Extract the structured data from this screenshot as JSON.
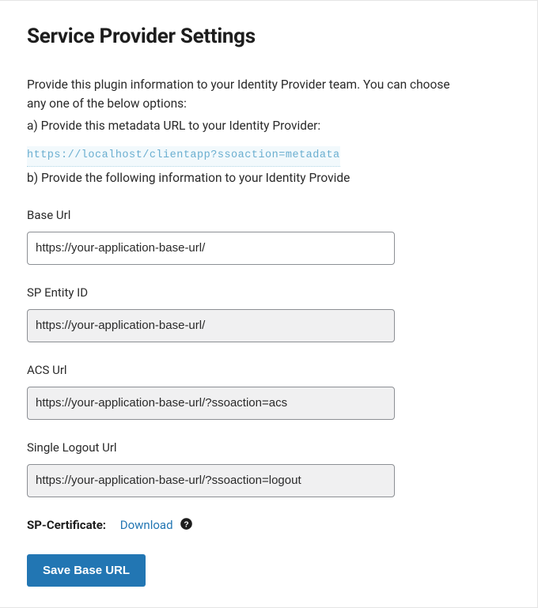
{
  "title": "Service Provider Settings",
  "intro": {
    "line1": "Provide this plugin information to your Identity Provider team. You can choose any one of the below options:",
    "optionA": "a) Provide this metadata URL to your Identity Provider:",
    "metadataUrl": "https://localhost/clientapp?ssoaction=metadata",
    "optionB": "b) Provide the following information to your Identity Provide"
  },
  "fields": {
    "baseUrl": {
      "label": "Base Url",
      "value": "https://your-application-base-url/"
    },
    "entityId": {
      "label": "SP Entity ID",
      "value": "https://your-application-base-url/"
    },
    "acsUrl": {
      "label": "ACS Url",
      "value": "https://your-application-base-url/?ssoaction=acs"
    },
    "logoutUrl": {
      "label": "Single Logout Url",
      "value": "https://your-application-base-url/?ssoaction=logout"
    }
  },
  "certificate": {
    "label": "SP-Certificate:",
    "link": "Download"
  },
  "actions": {
    "save": "Save Base URL"
  }
}
